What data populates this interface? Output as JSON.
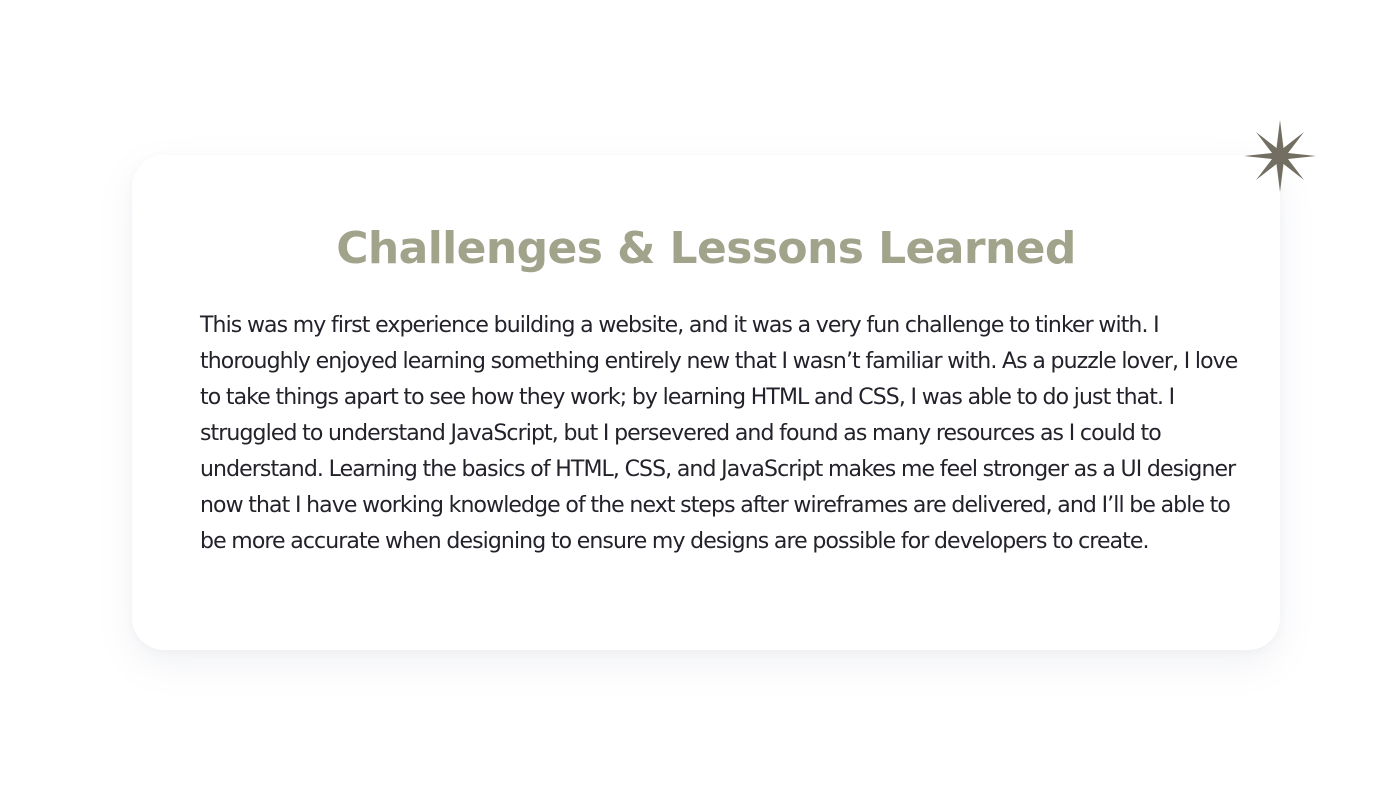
{
  "section": {
    "title": "Challenges & Lessons Learned",
    "body": "This was my first experience building a website, and it was a very fun challenge to tinker with. I thoroughly enjoyed learning something entirely new that I wasn’t familiar with. As a puzzle lover, I love to take things apart to see how they work; by learning HTML and CSS, I was able to do just that. I struggled to understand JavaScript, but I persevered and found as many resources as I could to understand. Learning the basics of HTML, CSS, and JavaScript makes me feel stronger as a UI designer now that I have working knowledge of the next steps after wireframes are delivered, and I’ll be able to be more accurate when designing to ensure my designs are possible for developers to create."
  },
  "decoration": {
    "icon": "sparkle-star-icon",
    "color": "#736e62"
  },
  "colors": {
    "title": "#a1a38b",
    "body_text": "#22222a",
    "card_background": "#ffffff",
    "page_background": "#ffffff"
  }
}
